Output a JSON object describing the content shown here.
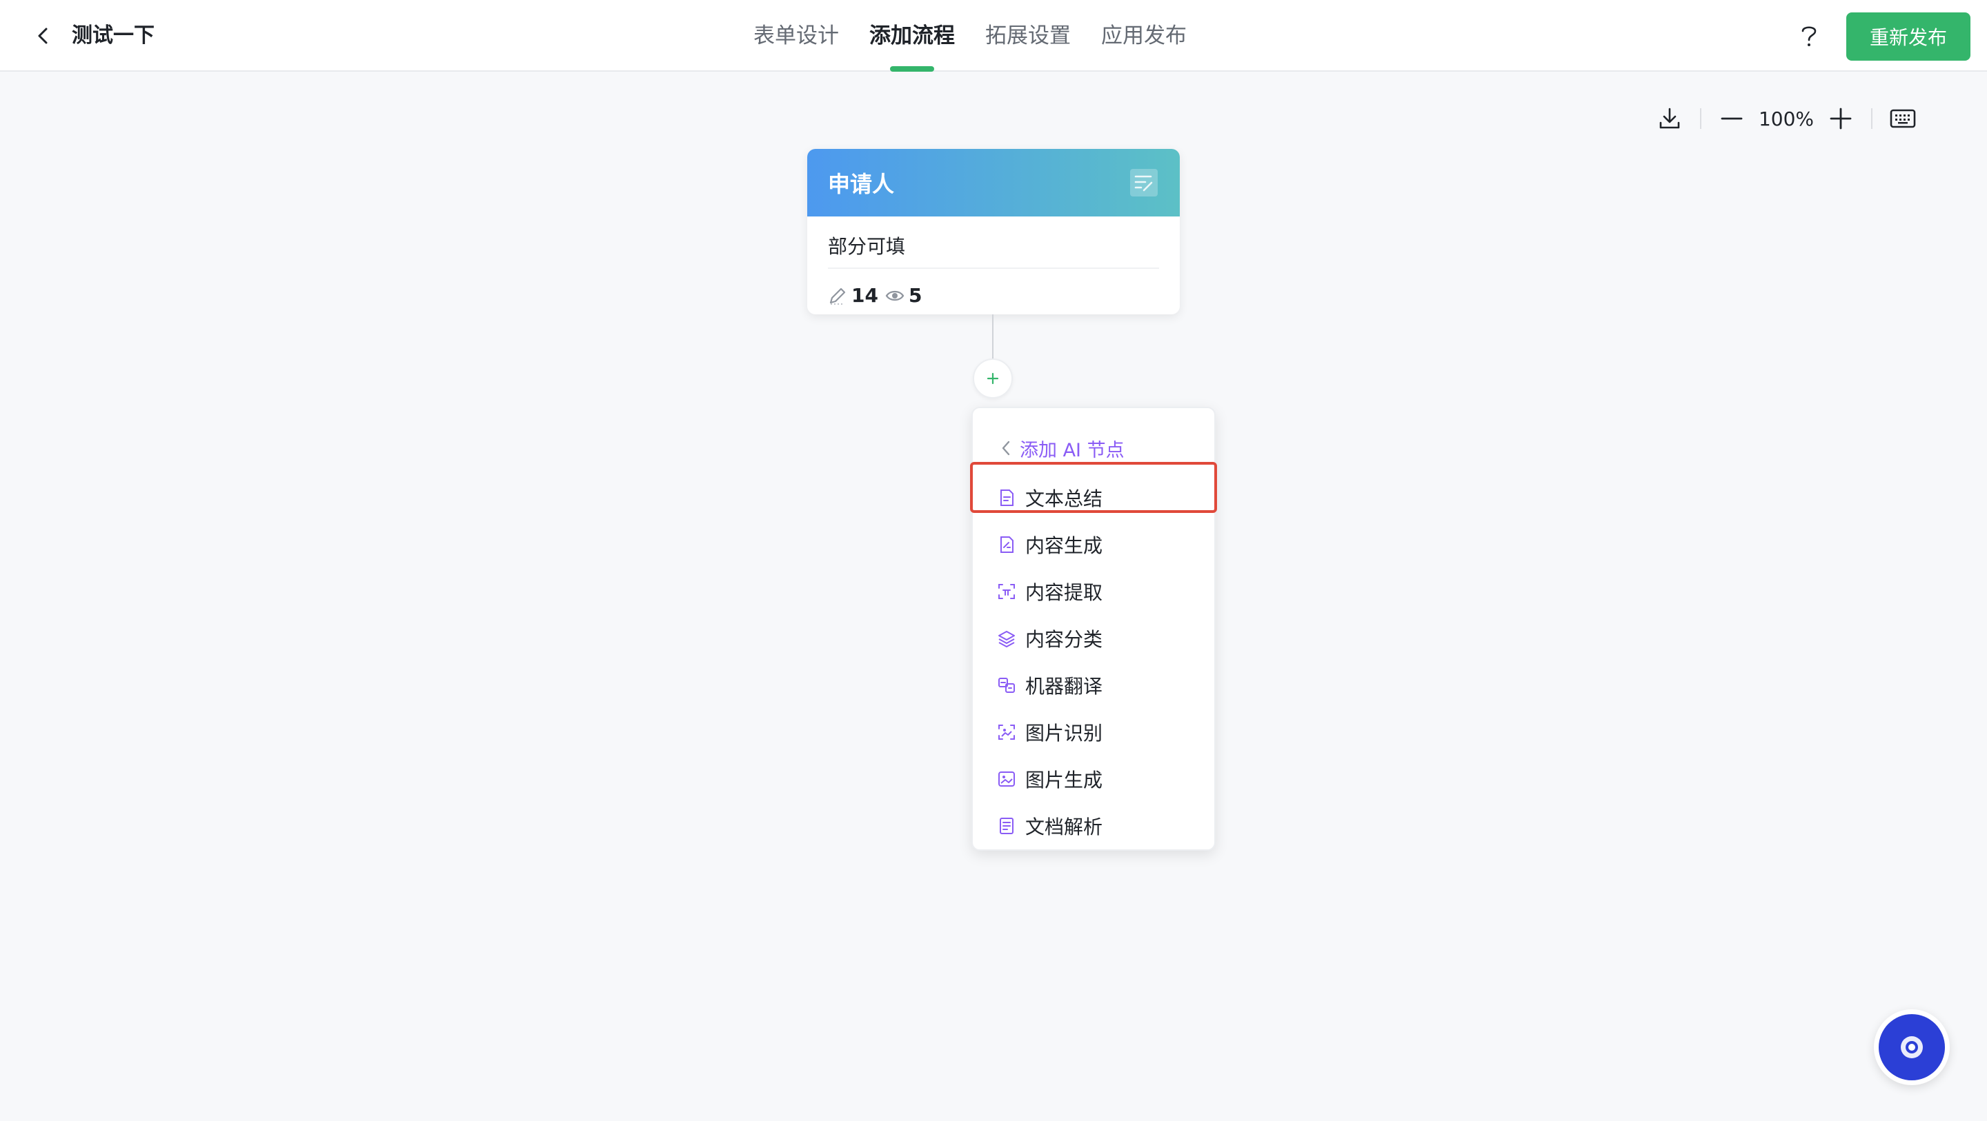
{
  "header": {
    "app_title": "测试一下",
    "tabs": [
      {
        "label": "表单设计",
        "active": false
      },
      {
        "label": "添加流程",
        "active": true
      },
      {
        "label": "拓展设置",
        "active": false
      },
      {
        "label": "应用发布",
        "active": false
      }
    ],
    "help_icon": "question-icon",
    "publish_label": "重新发布"
  },
  "toolbar": {
    "zoom": "100%",
    "icons": [
      "download-icon",
      "zoom-out-icon",
      "zoom-in-icon",
      "keyboard-icon"
    ]
  },
  "node": {
    "title": "申请人",
    "description": "部分可填",
    "edit_count": "14",
    "view_count": "5"
  },
  "menu": {
    "header": "添加 AI 节点",
    "items": [
      {
        "label": "文本总结",
        "icon": "text-summary-icon"
      },
      {
        "label": "内容生成",
        "icon": "content-generate-icon"
      },
      {
        "label": "内容提取",
        "icon": "content-extract-icon"
      },
      {
        "label": "内容分类",
        "icon": "layers-icon"
      },
      {
        "label": "机器翻译",
        "icon": "translate-icon"
      },
      {
        "label": "图片识别",
        "icon": "image-scan-icon"
      },
      {
        "label": "图片生成",
        "icon": "image-generate-icon"
      },
      {
        "label": "文档解析",
        "icon": "document-parse-icon"
      }
    ],
    "highlighted_index": 0
  },
  "colors": {
    "accent_green": "#34b56b",
    "menu_purple": "#8a5cf5",
    "highlight_red": "#e0493a",
    "node_gradient_start": "#4d99ef",
    "node_gradient_end": "#5cc0c6"
  }
}
